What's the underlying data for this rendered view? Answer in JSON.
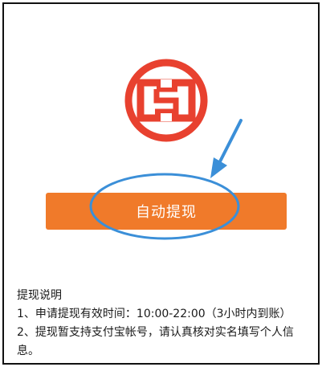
{
  "logo": {
    "icon": "bank-logo-icon",
    "color": "#e8412f"
  },
  "button": {
    "label": "自动提现",
    "bg": "#f07a2a"
  },
  "annotation": {
    "color": "#3b8fd8"
  },
  "notes": {
    "title": "提现说明",
    "items": [
      "1、申请提现有效时间：10:00-22:00（3小时内到账）",
      "2、提现暂支持支付宝帐号，请认真核对实名填写个人信息。"
    ]
  }
}
